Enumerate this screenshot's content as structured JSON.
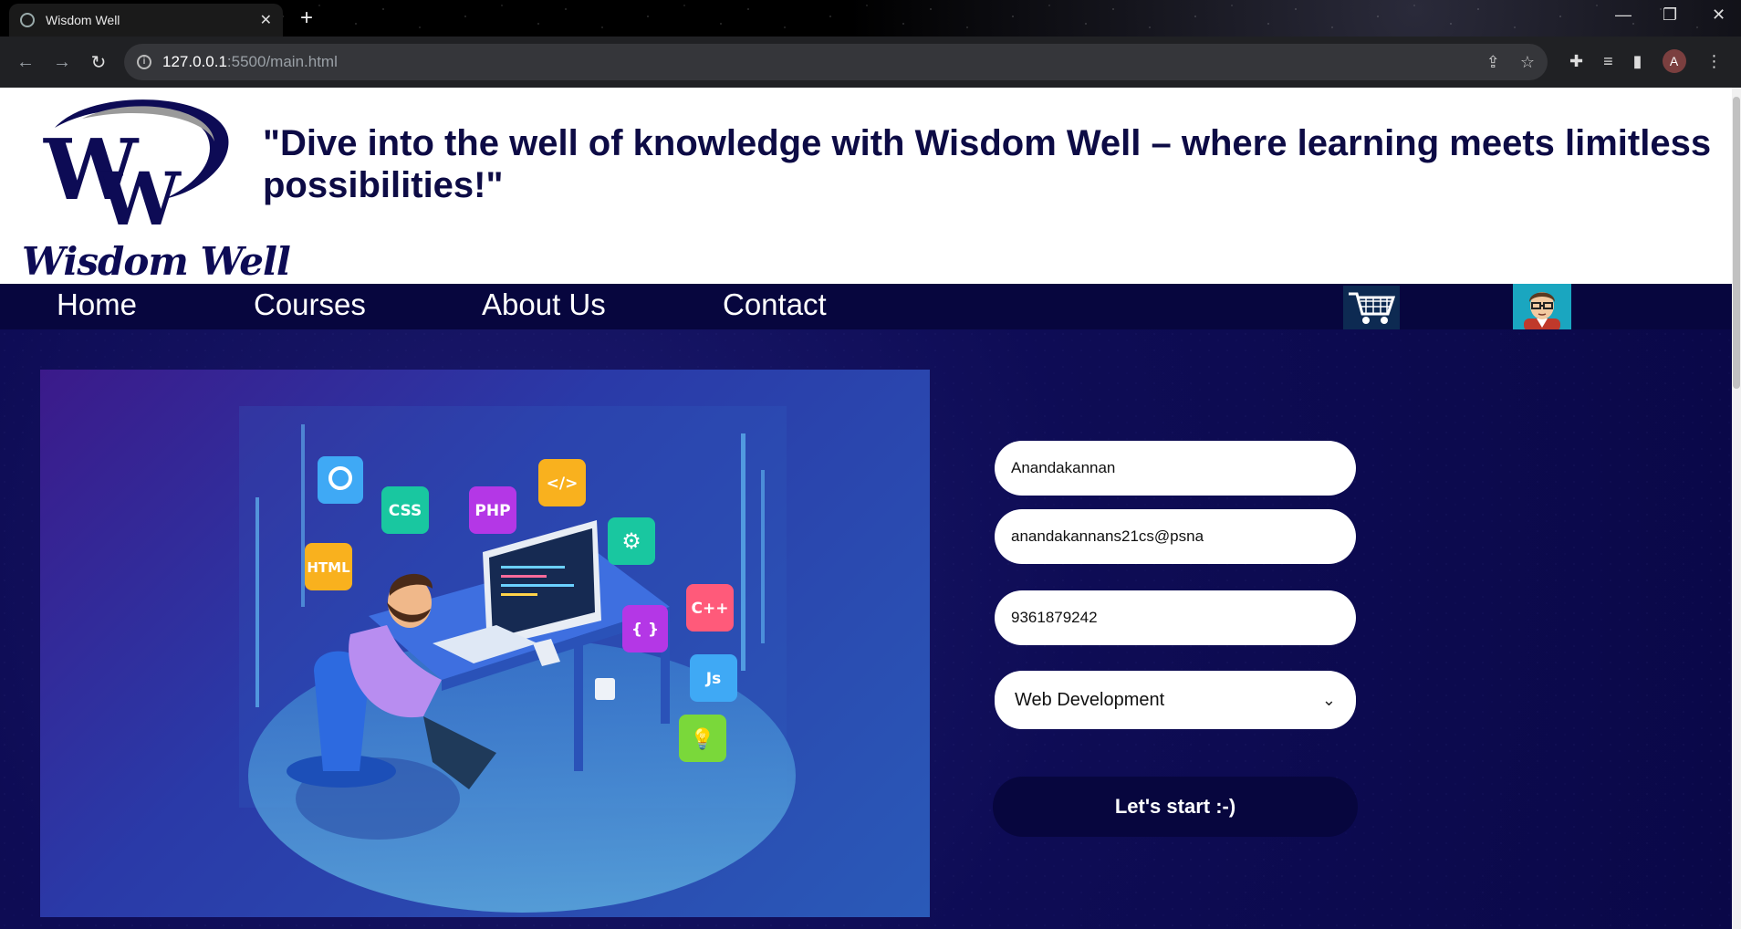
{
  "browser": {
    "tab_title": "Wisdom Well",
    "tab_close": "✕",
    "new_tab": "+",
    "url_host": "127.0.0.1",
    "url_path": ":5500/main.html",
    "profile_initial": "A",
    "window_controls": [
      "—",
      "❐",
      "✕"
    ]
  },
  "header": {
    "logo_text": "Wisdom Well",
    "tagline": "\"Dive into the well of knowledge with Wisdom Well – where learning meets limitless possibilities!\""
  },
  "nav": {
    "items": [
      {
        "label": "Home"
      },
      {
        "label": "Courses"
      },
      {
        "label": "About Us"
      },
      {
        "label": "Contact"
      }
    ]
  },
  "hero": {
    "tags": [
      "HTML",
      "CSS",
      "PHP",
      "</>",
      "C++",
      "{ }",
      "Js"
    ]
  },
  "form": {
    "name_value": "Anandakannan",
    "email_value": "anandakannans21cs@psna",
    "phone_value": "9361879242",
    "course_selected": "Web Development",
    "submit_label": "Let's start  :-)"
  },
  "colors": {
    "brand_navy": "#07063e",
    "page_bg": "#0e0c55",
    "header_bg": "#ffffff"
  }
}
